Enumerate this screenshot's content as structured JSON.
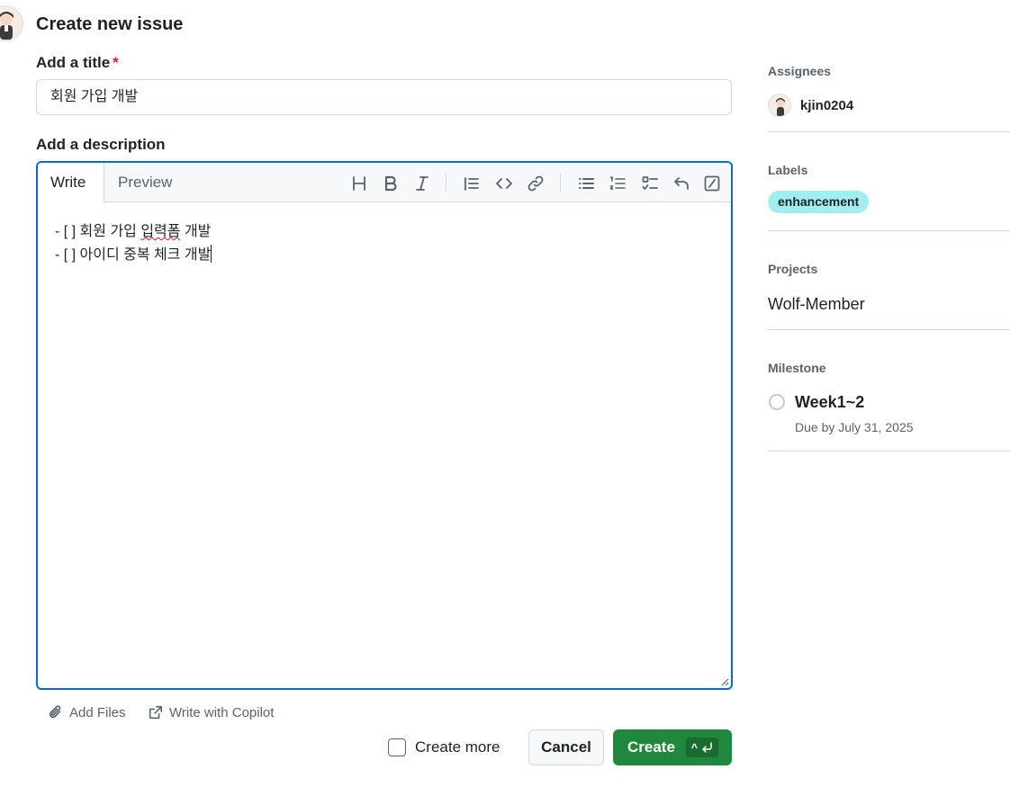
{
  "page": {
    "title": "Create new issue"
  },
  "title_field": {
    "label": "Add a title",
    "required_mark": "*",
    "value": "회원 가입 개발"
  },
  "description": {
    "label": "Add a description",
    "tabs": [
      "Write",
      "Preview"
    ],
    "toolbar_icons": [
      "heading-icon",
      "bold-icon",
      "italic-icon",
      "quote-icon",
      "code-icon",
      "link-icon",
      "bulleted-list-icon",
      "numbered-list-icon",
      "task-list-icon",
      "undo-icon",
      "slash-command-icon"
    ],
    "lines": {
      "line1_prefix": "- [ ] 회원 가입 ",
      "line1_spell": "입력폼",
      "line1_suffix": " 개발",
      "line2": "- [ ] 아이디 중복 체크 개발"
    }
  },
  "footer": {
    "add_files": "Add Files",
    "copilot": "Write with Copilot",
    "create_more": "Create more",
    "cancel": "Cancel",
    "create": "Create",
    "create_shortcut": "^"
  },
  "sidebar": {
    "assignees": {
      "heading": "Assignees",
      "user": "kjin0204"
    },
    "labels": {
      "heading": "Labels",
      "label": "enhancement",
      "label_color": "#a2eeef"
    },
    "projects": {
      "heading": "Projects",
      "project": "Wolf-Member"
    },
    "milestone": {
      "heading": "Milestone",
      "name": "Week1~2",
      "due": "Due by July 31, 2025"
    }
  },
  "colors": {
    "primary": "#1f883d",
    "focus": "#0969da",
    "required": "#cf222e"
  }
}
